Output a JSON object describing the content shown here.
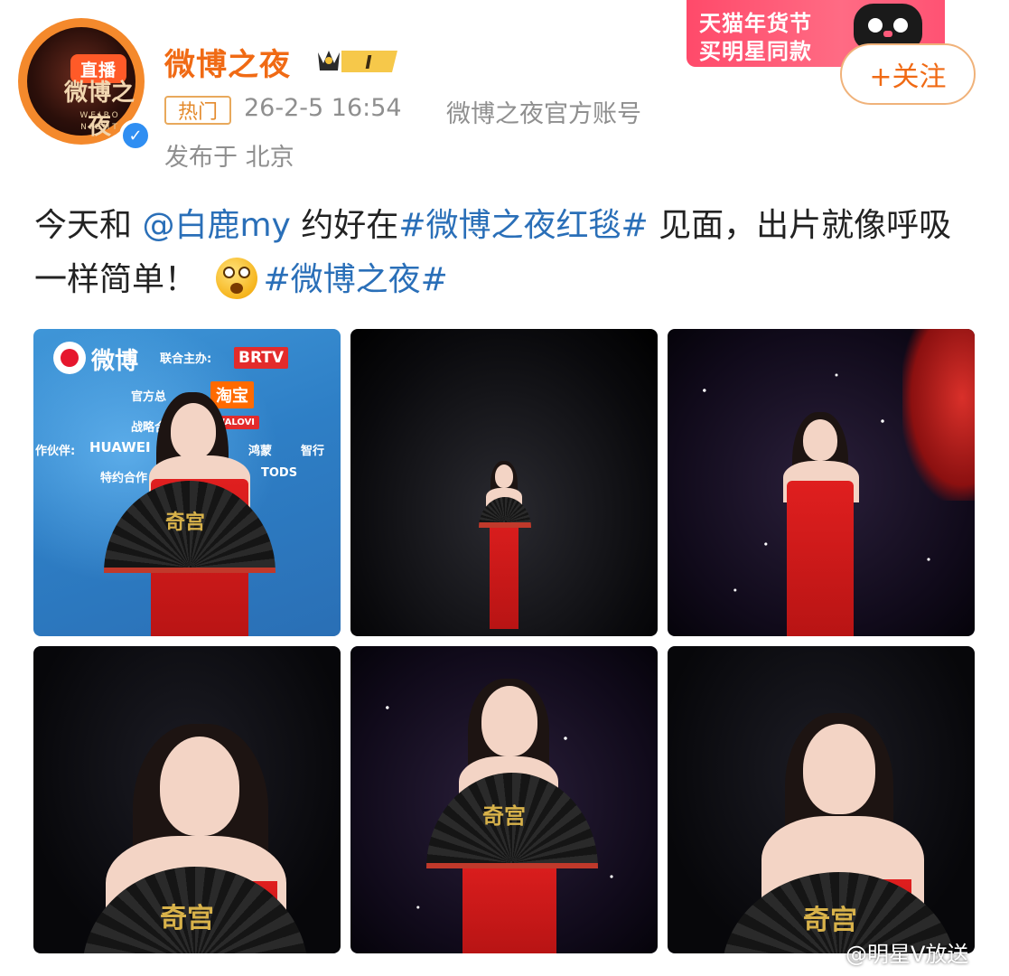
{
  "header": {
    "avatar": {
      "live_label": "直播",
      "logo_text": "微博之夜",
      "logo_sub": "WEIBO NIGHT",
      "verified_icon": "verified-v-icon"
    },
    "username": "微博之夜",
    "vip_level": "I",
    "hot_tag": "热门",
    "time": "26-2-5 16:54",
    "source": "微博之夜官方账号",
    "location": "发布于 北京",
    "follow_label": "+关注"
  },
  "ad": {
    "line1": "天猫年货节",
    "line2": "买明星同款"
  },
  "post": {
    "text_part1": "今天和",
    "mention": "@白鹿my",
    "text_part2": "约好在",
    "hashtag1": "#微博之夜红毯#",
    "text_part3": "见面，出片就像呼吸一样简单！",
    "emoji": "starstruck-emoji",
    "hashtag2": "#微博之夜#"
  },
  "photo1": {
    "weibo_logo": "微博",
    "host_label": "联合主办:",
    "brtv": "BRTV",
    "official_label": "官方总",
    "taobao": "淘宝",
    "strategy_label": "战略合",
    "walovi": "WALOVI",
    "partner_label": "作伙伴:",
    "huawei": "HUAWEI",
    "hongmeng": "鸿蒙",
    "zhihang": "智行",
    "special_label": "特约合作",
    "tods": "TODS"
  },
  "fan_text": "奇宫",
  "watermark": "@明星V放送",
  "colors": {
    "accent": "#f06a14",
    "link": "#2a6fb8",
    "meta": "#8f8f8f"
  }
}
